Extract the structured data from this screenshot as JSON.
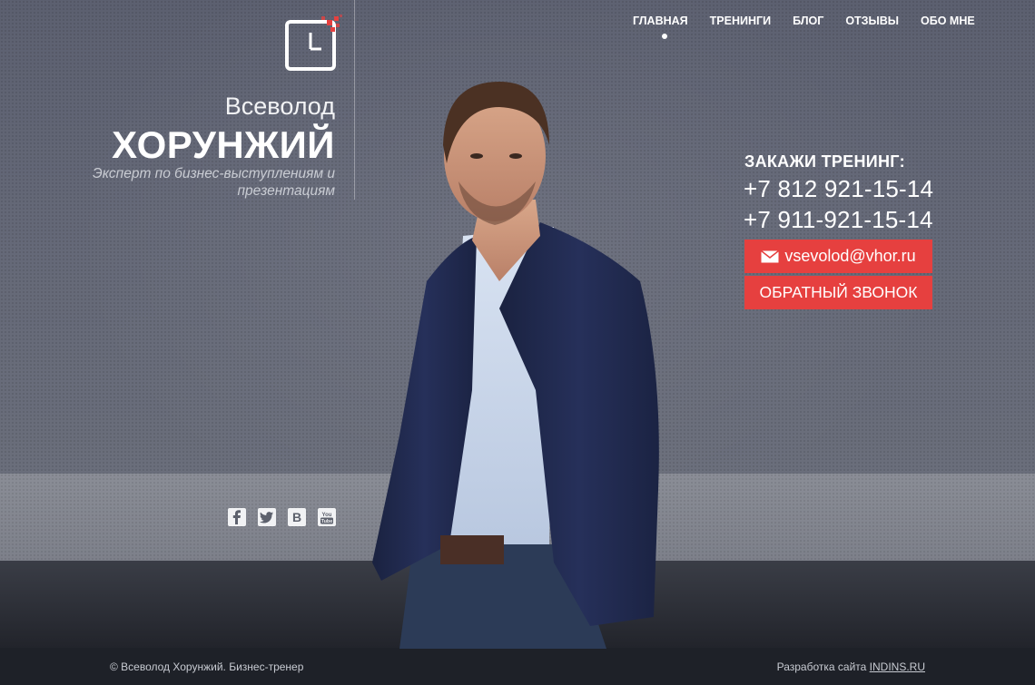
{
  "brand": {
    "first_name": "Всеволод",
    "last_name": "ХОРУНЖИЙ",
    "tagline": "Эксперт по бизнес-выступлениям и презентациям",
    "logo_icon": "clock-logo-icon"
  },
  "nav": {
    "items": [
      {
        "label": "ГЛАВНАЯ",
        "active": true
      },
      {
        "label": "ТРЕНИНГИ",
        "active": false
      },
      {
        "label": "БЛОГ",
        "active": false
      },
      {
        "label": "ОТЗЫВЫ",
        "active": false
      },
      {
        "label": "ОБО МНЕ",
        "active": false
      }
    ]
  },
  "contact": {
    "order_label": "ЗАКАЖИ ТРЕНИНГ:",
    "phone1": "+7 812 921-15-14",
    "phone2": "+7 911-921-15-14",
    "email_button": "vsevolod@vhor.ru",
    "callback_button": "ОБРАТНЫЙ ЗВОНОК",
    "accent_color": "#e6403f"
  },
  "social": {
    "icons": [
      "facebook-icon",
      "twitter-icon",
      "vk-icon",
      "youtube-icon"
    ]
  },
  "footer": {
    "copyright": "© Всеволод Хорунжий. Бизнес-тренер",
    "dev_prefix": "Разработка сайта",
    "dev_link": "INDINS.RU"
  }
}
